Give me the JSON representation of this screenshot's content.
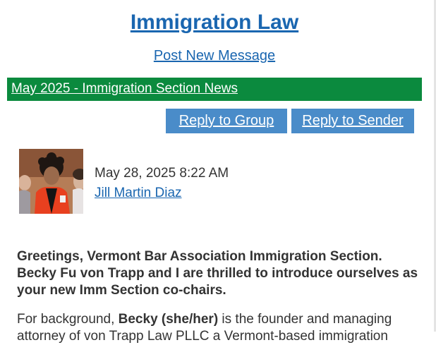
{
  "header": {
    "title": "Immigration Law",
    "post_new_message": "Post New Message"
  },
  "subject": "May 2025 - Immigration Section News",
  "actions": {
    "reply_group": "Reply to Group",
    "reply_sender": "Reply to Sender"
  },
  "message": {
    "date": "May 28, 2025 8:22 AM",
    "author": "Jill Martin Diaz",
    "greeting": "Greetings, Vermont Bar Association Immigration Section. Becky Fu von Trapp and I are thrilled to introduce ourselves as your new Imm Section co-chairs.",
    "para_prefix": "For background, ",
    "para_bold": "Becky (she/her)",
    "para_suffix": " is the founder and managing",
    "para_line2": "attorney of von Trapp Law PLLC a Vermont-based immigration"
  },
  "colors": {
    "link": "#1a66b0",
    "subject_bar": "#0b8a3e",
    "button": "#4a8cc9"
  }
}
